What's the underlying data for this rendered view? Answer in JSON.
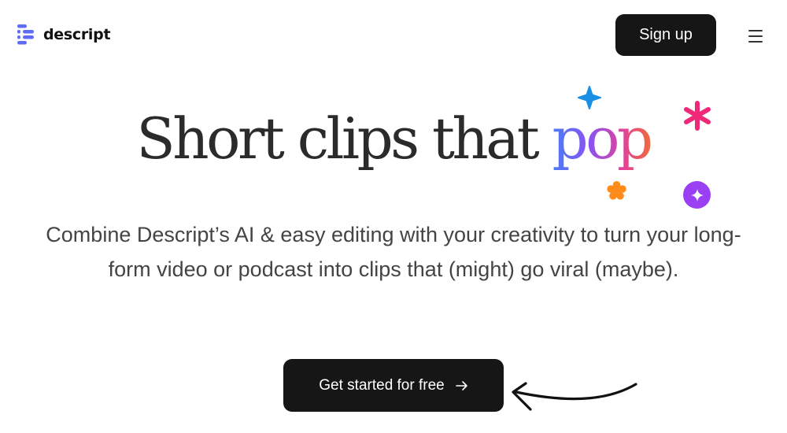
{
  "header": {
    "logo_text": "descript",
    "signup_label": "Sign up",
    "menu_icon": "hamburger-menu-icon"
  },
  "hero": {
    "title_main": "Short clips that",
    "title_accent": "pop",
    "subtitle": "Combine Descript’s AI & easy editing with your creativity to turn your long-form video or podcast into clips that (might) go viral (maybe).",
    "cta_label": "Get started for free"
  },
  "colors": {
    "button_bg": "#161616",
    "logo_accent": "#5f6df5",
    "pop_gradient": [
      "#4a7cf7",
      "#8b53f0",
      "#e0429a",
      "#f06b3a"
    ],
    "deco_blue": "#1a8fe3",
    "deco_pink": "#f0287a",
    "deco_orange": "#ff8c1a",
    "deco_purple": "#9b3ff4"
  },
  "icons": {
    "logo": "descript-logo-icon",
    "cta_arrow": "arrow-right-icon",
    "decorations": [
      "sparkle-star-icon",
      "asterisk-icon",
      "flower-icon",
      "sparkle-badge-icon",
      "hand-drawn-arrow-icon"
    ]
  }
}
